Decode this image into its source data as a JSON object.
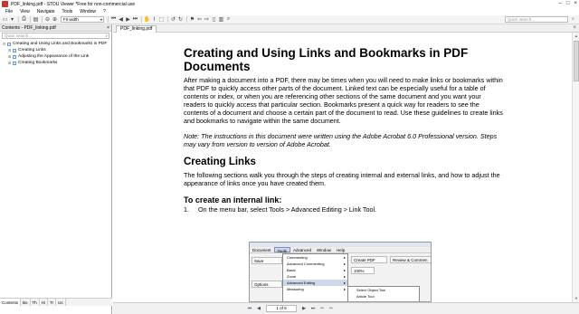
{
  "window": {
    "title": "PDF_linking.pdf - STDU Viewer *Free for non-commercial use",
    "controls": [
      "–",
      "□",
      "×"
    ]
  },
  "menubar": [
    "File",
    "View",
    "Navigate",
    "Tools",
    "Window",
    "?"
  ],
  "toolbar": {
    "zoom_value": "Fit width",
    "quick_search_placeholder": "Quick search..."
  },
  "sidebar": {
    "title": "Contents - PDF_linking.pdf",
    "search_placeholder": "Quick search...",
    "items": [
      {
        "label": "Creating and Using Links and Bookmarks in PDF",
        "expander": "⊟"
      },
      {
        "label": "Creating Links",
        "expander": "⊞"
      },
      {
        "label": "Adjusting the Appearance of the Link",
        "expander": "⊞"
      },
      {
        "label": "Creating Bookmarks",
        "expander": "⊞"
      }
    ],
    "tabs": [
      "Contents",
      "Bo",
      "Th",
      "Hi",
      "Tr",
      "Us"
    ]
  },
  "document_tab": {
    "label": "PDF_linking.pdf"
  },
  "document": {
    "title": "Creating and Using Links and Bookmarks in PDF Documents",
    "intro": "After making a document into a PDF, there may be times when you will need to make links or bookmarks within that PDF to quickly access other parts of the document. Linked text can be especially useful for a table of contents or index, or when you are referencing other sections of the same document and you want your readers to quickly access that particular section. Bookmarks present a quick way for readers to see the contents of a document and choose a certain part of the document to read. Use these guidelines to create links and bookmarks to navigate within the same document.",
    "note": "Note: The instructions in this document were written using the Adobe Acrobat 6.0 Professional version. Steps may vary from version to version of Adobe Acrobat.",
    "section_heading": "Creating Links",
    "section_text": "The following sections walk you through the steps of creating internal and external links, and how to adjust the appearance of links once you have created them.",
    "subheading": "To create an internal link:",
    "step_number": "1.",
    "step_text": "On the menu bar, select Tools > Advanced Editing > Link Tool."
  },
  "embedded_screenshot": {
    "menus": [
      "Document",
      "Tools",
      "Advanced",
      "Window",
      "Help"
    ],
    "left_buttons": [
      "Save",
      "Options"
    ],
    "dropdown": [
      "Commenting",
      "Advanced Commenting",
      "Basic",
      "Zoom",
      "Advanced Editing",
      "Measuring"
    ],
    "submenu": [
      "Select Object Tool",
      "Article Tool"
    ],
    "right_buttons": [
      "Create PDF",
      "Review & Commen",
      "100%"
    ]
  },
  "navigation": {
    "page_indicator": "1 of 9"
  }
}
